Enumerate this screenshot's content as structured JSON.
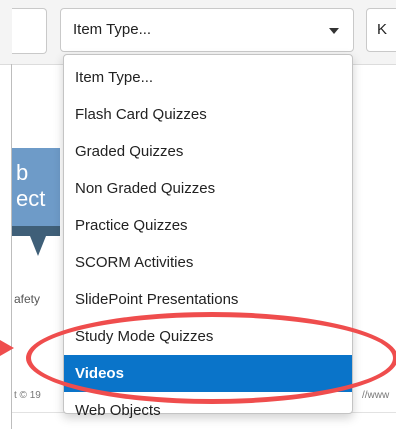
{
  "filter": {
    "item_type_selected": "Item Type...",
    "right_input_partial": "K"
  },
  "dropdown": {
    "items": [
      {
        "label": "Item Type..."
      },
      {
        "label": "Flash Card Quizzes"
      },
      {
        "label": "Graded Quizzes"
      },
      {
        "label": "Non Graded Quizzes"
      },
      {
        "label": "Practice Quizzes"
      },
      {
        "label": "SCORM Activities"
      },
      {
        "label": "SlidePoint Presentations"
      },
      {
        "label": "Study Mode Quizzes"
      },
      {
        "label": "Videos"
      },
      {
        "label": "Web Objects"
      }
    ],
    "highlighted": "Videos",
    "highlight_color": "#0a74c9"
  },
  "background": {
    "thumb_text": "b\nect",
    "partial_text": "afety",
    "footer_left_partial": "t © 19",
    "footer_right_partial": "//www"
  },
  "annotation": {
    "color": "#ef4d4d",
    "target": "Videos"
  }
}
